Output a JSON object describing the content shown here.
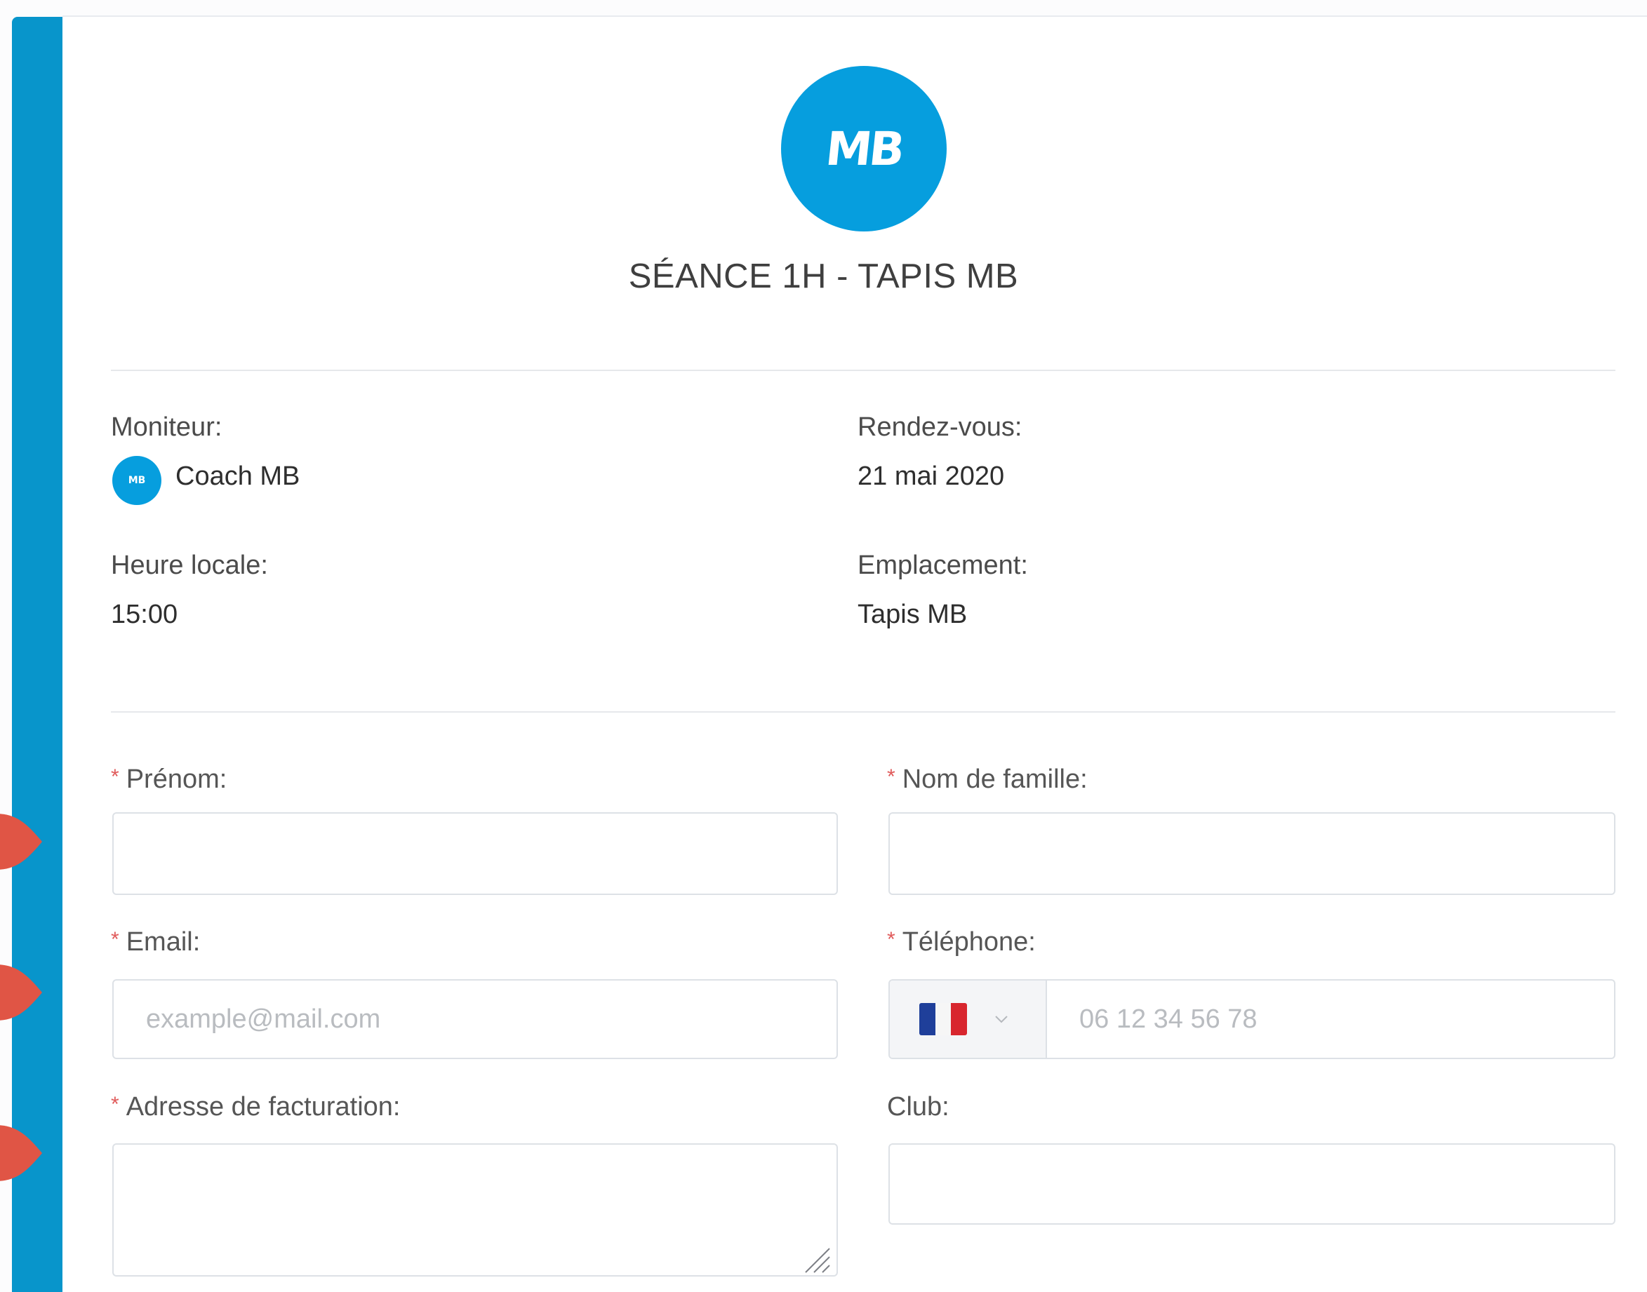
{
  "service": {
    "logo_text": "MB",
    "title": "SÉANCE 1H - TAPIS MB"
  },
  "details": {
    "instructor_label": "Moniteur:",
    "instructor_avatar_text": "MB",
    "instructor_name": "Coach MB",
    "appointment_label": "Rendez-vous:",
    "appointment_date": "21 mai 2020",
    "local_time_label": "Heure locale:",
    "local_time": "15:00",
    "location_label": "Emplacement:",
    "location": "Tapis MB"
  },
  "form": {
    "required_marker": "*",
    "first_name_label": "Prénom:",
    "first_name_value": "",
    "last_name_label": "Nom de famille:",
    "last_name_value": "",
    "email_label": "Email:",
    "email_placeholder": "example@mail.com",
    "phone_label": "Téléphone:",
    "phone_country": "France",
    "phone_placeholder": "06 12 34 56 78",
    "billing_address_label": "Adresse de facturation:",
    "billing_address_value": "",
    "club_label": "Club:",
    "club_value": ""
  },
  "colors": {
    "accent": "#069ede",
    "stripe": "#0895cb",
    "required": "#e05b5b",
    "annotation_arrow": "#e05545"
  }
}
